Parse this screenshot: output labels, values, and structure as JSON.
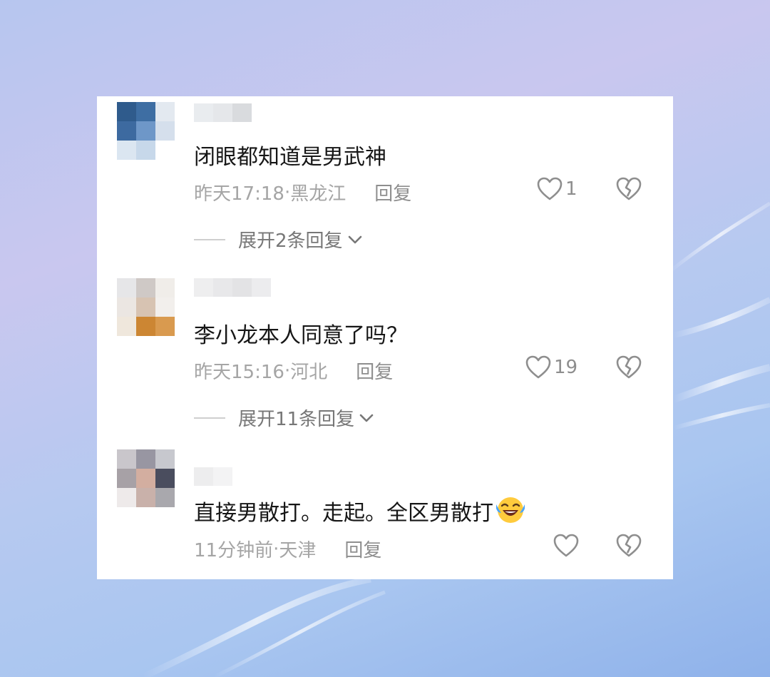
{
  "comments": [
    {
      "content": "闭眼都知道是男武神",
      "time": "昨天17:18",
      "location": "黑龙江",
      "reply_label": "回复",
      "likes": "1",
      "expand_label": "展开2条回复"
    },
    {
      "content": "李小龙本人同意了吗？",
      "time": "昨天15:16",
      "location": "河北",
      "reply_label": "回复",
      "likes": "19",
      "expand_label": "展开11条回复"
    },
    {
      "content": "直接男散打。走起。全区男散打",
      "time": "11分钟前",
      "location": "天津",
      "reply_label": "回复",
      "likes": ""
    }
  ],
  "meta_separator": " · ",
  "icons": {
    "like": "heart-outline-icon",
    "dislike": "broken-heart-icon",
    "expand": "chevron-down-icon",
    "emoji": "laughing-tears-emoji"
  },
  "colors": {
    "card": "#ffffff",
    "text": "#161616",
    "meta": "#a5a5a5",
    "icon": "#8e8e8e"
  }
}
